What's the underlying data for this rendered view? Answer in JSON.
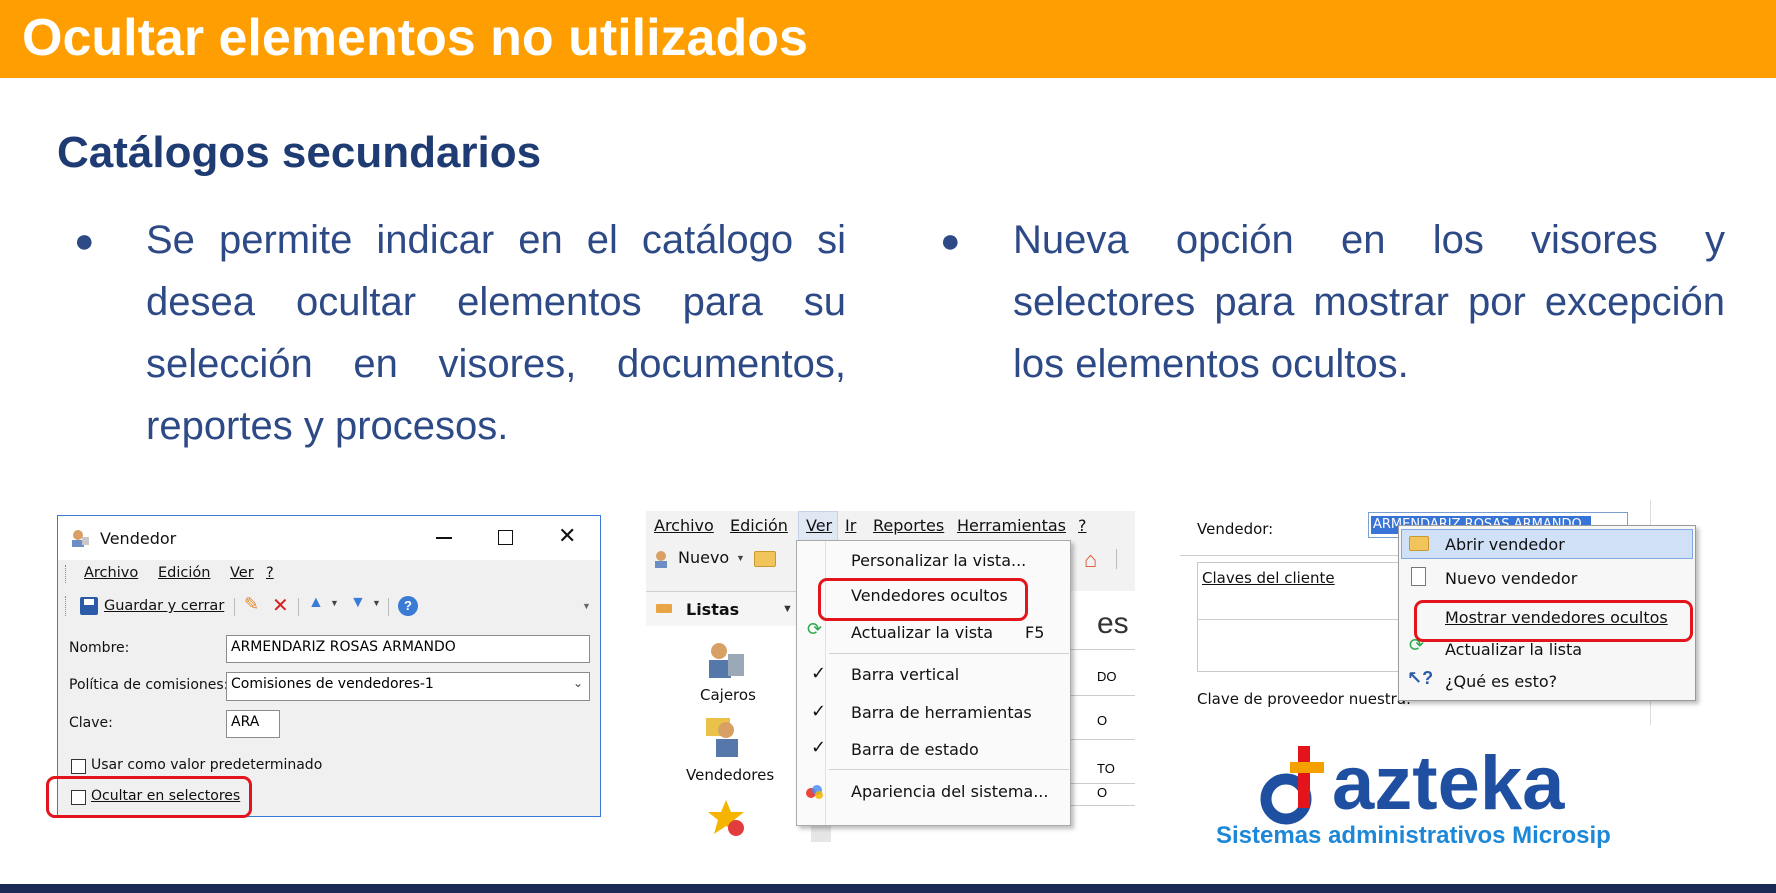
{
  "slide": {
    "title": "Ocultar elementos no utilizados",
    "subtitle": "Catálogos secundarios",
    "bullet_left": "Se permite indicar en el catálogo si desea ocultar elementos para su selección en visores, documentos, reportes y procesos.",
    "bullet_right": "Nueva opción en los visores y selectores para mostrar por excepción los elementos ocultos.",
    "bullet_glyph": "●"
  },
  "vendedor_window": {
    "title": "Vendedor",
    "menu": [
      "Archivo",
      "Edición",
      "Ver",
      "?"
    ],
    "save_label": "Guardar y cerrar",
    "labels": {
      "nombre": "Nombre:",
      "politica": "Política de comisiones:",
      "clave": "Clave:",
      "usar_default": "Usar como valor predeterminado",
      "ocultar": "Ocultar en selectores"
    },
    "values": {
      "nombre": "ARMENDARIZ ROSAS ARMANDO",
      "politica": "Comisiones de vendedores-1",
      "clave": "ARA"
    }
  },
  "ver_menu_window": {
    "menubar": [
      "Archivo",
      "Edición",
      "Ver",
      "Ir",
      "Reportes",
      "Herramientas",
      "?"
    ],
    "nuevo_label": "Nuevo",
    "listas_label": "Listas",
    "nav_items": [
      "Cajeros",
      "Vendedores"
    ],
    "menu_items": [
      {
        "label": "Personalizar la vista...",
        "shortcut": ""
      },
      {
        "label": "Vendedores ocultos",
        "shortcut": ""
      },
      {
        "label": "Actualizar la vista",
        "shortcut": "F5"
      },
      {
        "label": "Barra vertical",
        "shortcut": ""
      },
      {
        "label": "Barra de herramientas",
        "shortcut": ""
      },
      {
        "label": "Barra de estado",
        "shortcut": ""
      },
      {
        "label": "Apariencia del sistema...",
        "shortcut": ""
      }
    ],
    "bg_fragments": [
      "es",
      "DO",
      "O",
      "TO",
      "O"
    ]
  },
  "selector_window": {
    "vendedor_label": "Vendedor:",
    "vendedor_value": "ARMENDARIZ ROSAS ARMANDO",
    "claves_label": "Claves del cliente",
    "clave_proveedor_label": "Clave de proveedor nuestra:",
    "context_menu": [
      "Abrir vendedor",
      "Nuevo vendedor",
      "Mostrar vendedores ocultos",
      "Actualizar la lista",
      "¿Qué es esto?"
    ]
  },
  "logo": {
    "brand": "dazteka",
    "tagline": "Sistemas administrativos Microsip"
  },
  "colors": {
    "title_bar": "#FF9E00",
    "text_blue": "#2D4A86",
    "highlight_red": "#E3141B",
    "footer": "#1B2A55"
  }
}
